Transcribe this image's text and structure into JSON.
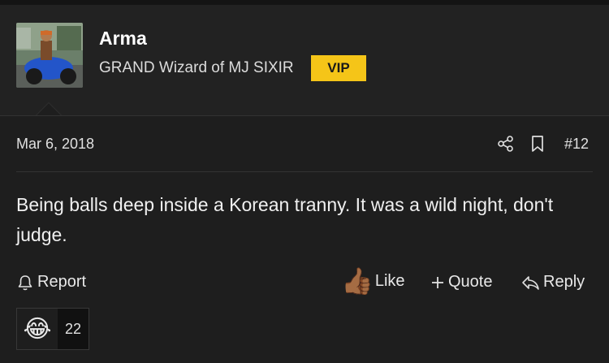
{
  "user": {
    "name": "Arma",
    "title": "GRAND Wizard of MJ SIXIR",
    "badge": "VIP"
  },
  "post": {
    "date": "Mar 6, 2018",
    "number": "#12",
    "body": "Being balls deep inside a Korean tranny. It was a wild night, don't judge."
  },
  "actions": {
    "report": "Report",
    "like": "Like",
    "like_emoji": "👍🏾",
    "quote": "Quote",
    "reply": "Reply"
  },
  "reactions": {
    "emoji": "😂",
    "count": "22"
  },
  "colors": {
    "background": "#1e1e1e",
    "header_background": "#222222",
    "badge": "#f5c518"
  },
  "icons": [
    "share-icon",
    "bookmark-icon",
    "bell-icon",
    "plus-icon",
    "reply-arrow-icon",
    "thumbs-up-icon",
    "laughing-emoji-icon"
  ]
}
